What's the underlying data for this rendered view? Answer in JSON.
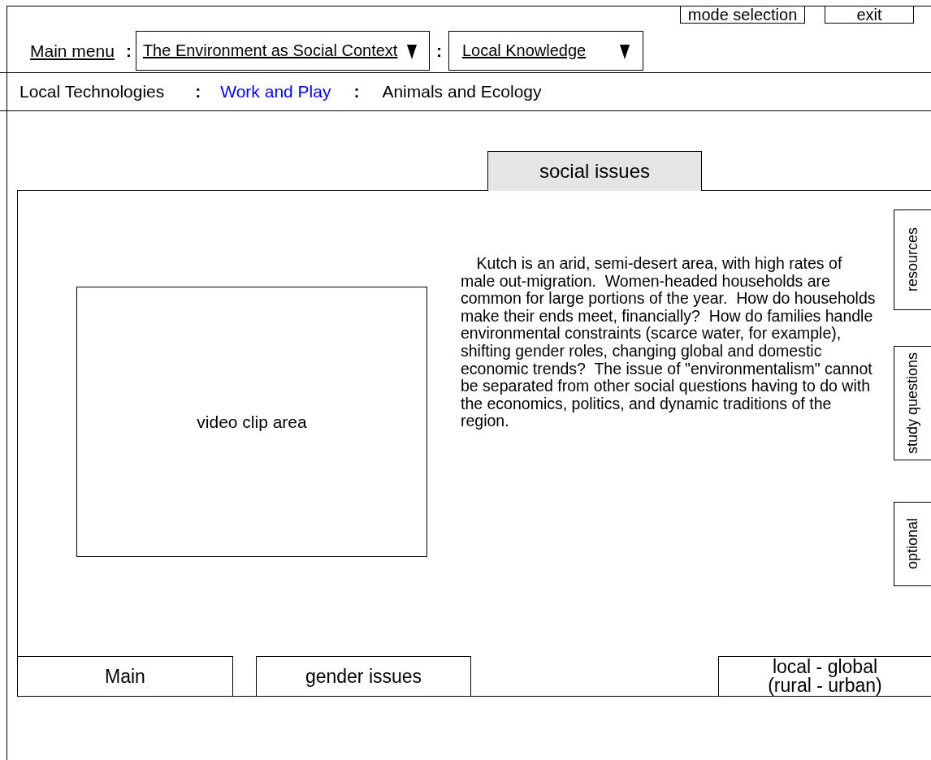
{
  "top_buttons": [
    {
      "label": "mode selection"
    },
    {
      "label": "exit"
    }
  ],
  "main_menu": {
    "label": "Main menu",
    "separator": ":",
    "dropdowns": [
      {
        "value": "The Environment as Social Context"
      },
      {
        "value": "Local Knowledge"
      }
    ]
  },
  "subnav": {
    "separator": ":",
    "items": [
      {
        "label": "Local Technologies",
        "selected": false
      },
      {
        "label": "Work and Play",
        "selected": true
      },
      {
        "label": "Animals and Ecology",
        "selected": false
      }
    ]
  },
  "tabs": [
    {
      "label": "social issues",
      "kind": "top",
      "selected": true
    },
    {
      "label": "Main",
      "kind": "bottom",
      "selected": false
    },
    {
      "label": "gender issues",
      "kind": "bottom",
      "selected": false
    },
    {
      "label": "local - global\n(rural - urban)",
      "kind": "bottom",
      "selected": false
    }
  ],
  "video": {
    "label": "video clip area"
  },
  "description": "Kutch is an arid, semi-desert area, with high rates of male out-migration.  Women-headed households are common for large portions of the year.  How do households make their ends meet, financially?  How do families handle environmental constraints (scarce water, for example), shifting gender roles, changing global and domestic economic trends?  The issue of \"environmentalism\" cannot be separated from other social questions having to do with the economics, politics, and dynamic traditions of the region.",
  "side_tabs": [
    {
      "label": "resources"
    },
    {
      "label": "study questions"
    },
    {
      "label": "optional"
    }
  ]
}
